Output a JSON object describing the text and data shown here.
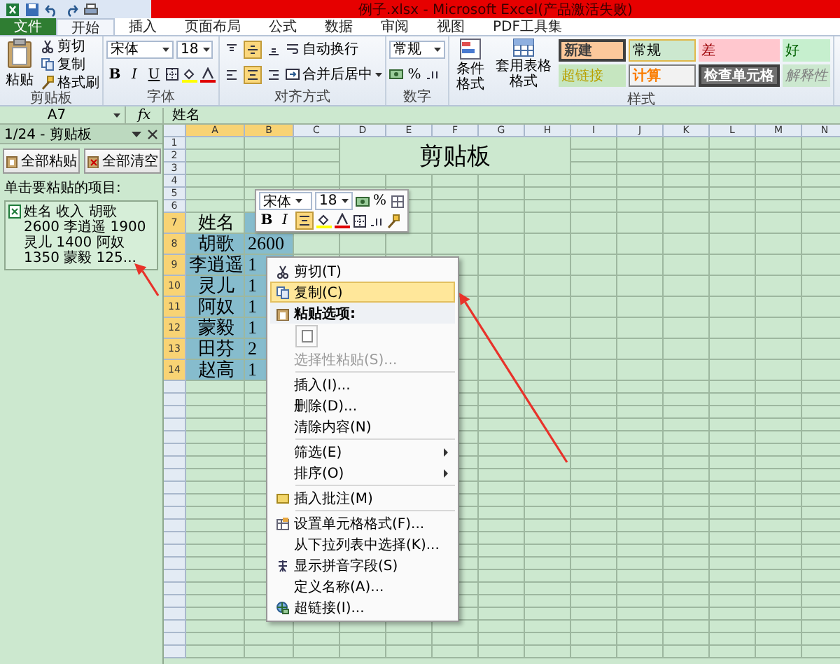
{
  "window": {
    "title": "例子.xlsx - Microsoft Excel(产品激活失败)"
  },
  "tabs": [
    {
      "label": "文件",
      "kind": "file",
      "selected": false
    },
    {
      "label": "开始",
      "kind": "tab",
      "selected": true
    },
    {
      "label": "插入",
      "kind": "tab",
      "selected": false
    },
    {
      "label": "页面布局",
      "kind": "tab",
      "selected": false
    },
    {
      "label": "公式",
      "kind": "tab",
      "selected": false
    },
    {
      "label": "数据",
      "kind": "tab",
      "selected": false
    },
    {
      "label": "审阅",
      "kind": "tab",
      "selected": false
    },
    {
      "label": "视图",
      "kind": "tab",
      "selected": false
    },
    {
      "label": "PDF工具集",
      "kind": "tab",
      "selected": false
    }
  ],
  "ribbon": {
    "groups": [
      {
        "kind": "clipboard",
        "label": "剪贴板",
        "paste": "粘贴",
        "commands": [
          "剪切",
          "复制",
          "格式刷"
        ]
      },
      {
        "kind": "font",
        "label": "字体",
        "font": "宋体",
        "size": "18",
        "styles": [
          "B",
          "I",
          "U"
        ]
      },
      {
        "kind": "alignment",
        "label": "对齐方式",
        "vertical": [
          {
            "selected": false
          },
          {
            "selected": true
          },
          {
            "selected": false
          }
        ],
        "horizontal": [
          {
            "selected": false
          },
          {
            "selected": true
          },
          {
            "selected": false
          }
        ],
        "wrap": "自动换行",
        "merge": "合并后居中"
      },
      {
        "kind": "number",
        "label": "数字",
        "format": "常规",
        "percent": "%"
      },
      {
        "kind": "styles",
        "label": "样式",
        "conditional": "条件格式",
        "table": "套用表格格式",
        "cells": [
          {
            "label": "新建",
            "kind": "neutral"
          },
          {
            "label": "常规",
            "kind": "normal"
          },
          {
            "label": "差",
            "kind": "bad"
          },
          {
            "label": "好",
            "kind": "good"
          },
          {
            "label": "超链接",
            "kind": "link"
          },
          {
            "label": "计算",
            "kind": "calc"
          },
          {
            "label": "检查单元格",
            "kind": "check"
          },
          {
            "label": "解释性",
            "kind": "note"
          }
        ]
      }
    ]
  },
  "formula_bar": {
    "name_box": "A7",
    "function_label": "fx",
    "formula": "姓名"
  },
  "clipboard_pane": {
    "title": "1/24 - 剪贴板",
    "buttons": [
      "全部粘贴",
      "全部清空"
    ],
    "hint": "单击要粘贴的项目:",
    "items": [
      "姓名 收入 胡歌 2600 李逍遥 1900 灵儿 1400 阿奴 1350 蒙毅 125..."
    ]
  },
  "sheet": {
    "columns": [
      {
        "label": "A",
        "selected": true
      },
      {
        "label": "B",
        "selected": true
      },
      {
        "label": "C",
        "selected": false
      },
      {
        "label": "D",
        "selected": false
      },
      {
        "label": "E",
        "selected": false
      },
      {
        "label": "F",
        "selected": false
      },
      {
        "label": "G",
        "selected": false
      },
      {
        "label": "H",
        "selected": false
      },
      {
        "label": "I",
        "selected": false
      },
      {
        "label": "J",
        "selected": false
      },
      {
        "label": "K",
        "selected": false
      },
      {
        "label": "L",
        "selected": false
      },
      {
        "label": "M",
        "selected": false
      },
      {
        "label": "N",
        "selected": false
      }
    ],
    "rows": [
      {
        "label": "1",
        "selected": false
      },
      {
        "label": "2",
        "selected": false
      },
      {
        "label": "3",
        "selected": false
      },
      {
        "label": "4",
        "selected": false
      },
      {
        "label": "5",
        "selected": false
      },
      {
        "label": "6",
        "selected": false
      },
      {
        "label": "7",
        "selected": true,
        "cells": [
          {
            "text": "姓名",
            "selected": false
          },
          {
            "selected": true
          }
        ]
      },
      {
        "label": "8",
        "selected": true,
        "cells": [
          {
            "text": "胡歌",
            "selected": true
          },
          {
            "text": "2600",
            "selected": true
          }
        ]
      },
      {
        "label": "9",
        "selected": true,
        "cells": [
          {
            "text": "李逍遥",
            "selected": true
          },
          {
            "text": "1",
            "selected": true
          }
        ]
      },
      {
        "label": "10",
        "selected": true,
        "cells": [
          {
            "text": "灵儿",
            "selected": true
          },
          {
            "text": "1",
            "selected": true
          }
        ]
      },
      {
        "label": "11",
        "selected": true,
        "cells": [
          {
            "text": "阿奴",
            "selected": true
          },
          {
            "text": "1",
            "selected": true
          }
        ]
      },
      {
        "label": "12",
        "selected": true,
        "cells": [
          {
            "text": "蒙毅",
            "selected": true
          },
          {
            "text": "1",
            "selected": true
          }
        ]
      },
      {
        "label": "13",
        "selected": true,
        "cells": [
          {
            "text": "田芬",
            "selected": true
          },
          {
            "text": "2",
            "selected": true
          }
        ]
      },
      {
        "label": "14",
        "selected": true,
        "cells": [
          {
            "text": "赵高",
            "selected": true
          },
          {
            "text": "1",
            "selected": true
          }
        ]
      }
    ],
    "merged_cell": {
      "text": "剪贴板"
    }
  },
  "mini_toolbar": {
    "font": "宋体",
    "size": "18",
    "percent": "%",
    "bold": "B",
    "italic": "I",
    "center_align": {
      "selected": true
    }
  },
  "context_menu": {
    "items": [
      {
        "kind": "item",
        "label": "剪切(T)",
        "selected": false,
        "disabled": false
      },
      {
        "kind": "item",
        "label": "复制(C)",
        "selected": true,
        "disabled": false
      },
      {
        "kind": "header",
        "label": "粘贴选项:",
        "selected": false,
        "disabled": false
      },
      {
        "kind": "paste-options",
        "selected": false,
        "disabled": false
      },
      {
        "kind": "item",
        "label": "选择性粘贴(S)...",
        "selected": false,
        "disabled": true
      },
      {
        "kind": "separator"
      },
      {
        "kind": "item",
        "label": "插入(I)...",
        "selected": false,
        "disabled": false
      },
      {
        "kind": "item",
        "label": "删除(D)...",
        "selected": false,
        "disabled": false
      },
      {
        "kind": "item",
        "label": "清除内容(N)",
        "selected": false,
        "disabled": false
      },
      {
        "kind": "separator"
      },
      {
        "kind": "submenu",
        "label": "筛选(E)",
        "selected": false,
        "disabled": false
      },
      {
        "kind": "submenu",
        "label": "排序(O)",
        "selected": false,
        "disabled": false
      },
      {
        "kind": "separator"
      },
      {
        "kind": "item",
        "label": "插入批注(M)",
        "selected": false,
        "disabled": false
      },
      {
        "kind": "separator"
      },
      {
        "kind": "item",
        "label": "设置单元格格式(F)...",
        "selected": false,
        "disabled": false
      },
      {
        "kind": "item",
        "label": "从下拉列表中选择(K)...",
        "selected": false,
        "disabled": false
      },
      {
        "kind": "item",
        "label": "显示拼音字段(S)",
        "selected": false,
        "disabled": false
      },
      {
        "kind": "item",
        "label": "定义名称(A)...",
        "selected": false,
        "disabled": false
      },
      {
        "kind": "item",
        "label": "超链接(I)...",
        "selected": false,
        "disabled": false
      }
    ]
  }
}
